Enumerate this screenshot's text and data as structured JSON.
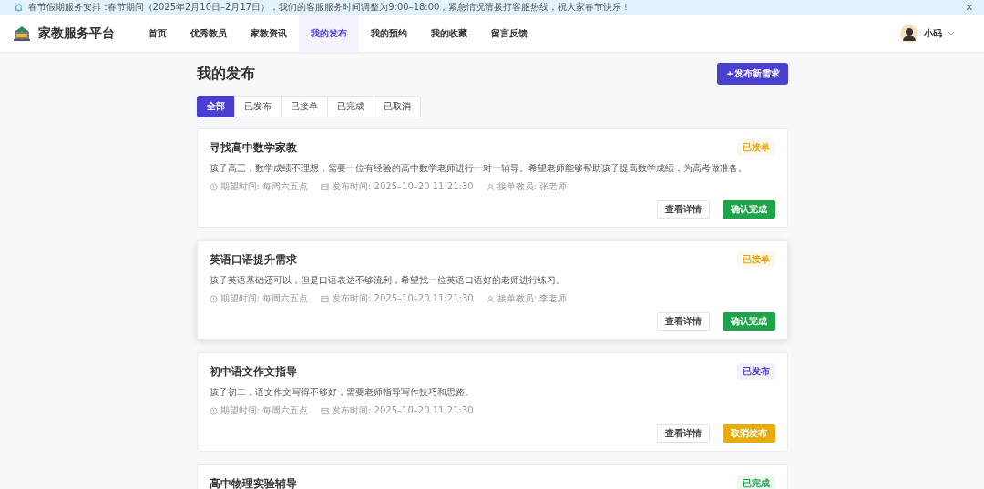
{
  "notice": {
    "text": "春节假期服务安排 :春节期间（2025年2月10日–2月17日），我们的客服服务时间调整为9:00–18:00，紧急情况请拨打客服热线，祝大家春节快乐！",
    "close": "×"
  },
  "header": {
    "brand": "家教服务平台",
    "nav": [
      {
        "label": "首页",
        "selected": false
      },
      {
        "label": "优秀教员",
        "selected": false
      },
      {
        "label": "家教资讯",
        "selected": false
      },
      {
        "label": "我的发布",
        "selected": true
      },
      {
        "label": "我的预约",
        "selected": false
      },
      {
        "label": "我的收藏",
        "selected": false
      },
      {
        "label": "留言反馈",
        "selected": false
      }
    ],
    "user": {
      "name": "小码"
    }
  },
  "page": {
    "title": "我的发布",
    "new_button": "＋发布新需求",
    "filters": [
      {
        "label": "全部",
        "selected": true
      },
      {
        "label": "已发布",
        "selected": false
      },
      {
        "label": "已接单",
        "selected": false
      },
      {
        "label": "已完成",
        "selected": false
      },
      {
        "label": "已取消",
        "selected": false
      }
    ],
    "cards": [
      {
        "title": "寻找高中数学家教",
        "status": "已接单",
        "color": "#e6a817",
        "highlighted": false,
        "description": "孩子高三，数学成绩不理想，需要一位有经验的高中数学老师进行一对一辅导。希望老师能够帮助孩子提高数学成绩，为高考做准备。",
        "expected": "期望时间: 每周六五点",
        "published": "发布时间: 2025–10–20 11:21:30",
        "teacher": "接单教员: 张老师",
        "actions": [
          {
            "label": "查看详情",
            "kind": "outline"
          },
          {
            "label": "确认完成",
            "kind": "success"
          }
        ]
      },
      {
        "title": "英语口语提升需求",
        "status": "已接单",
        "color": "#e6a817",
        "highlighted": true,
        "description": "孩子英语基础还可以，但是口语表达不够流利，希望找一位英语口语好的老师进行练习。",
        "expected": "期望时间: 每周六五点",
        "published": "发布时间: 2025–10–20 11:21:30",
        "teacher": "接单教员: 李老师",
        "actions": [
          {
            "label": "查看详情",
            "kind": "outline"
          },
          {
            "label": "确认完成",
            "kind": "success"
          }
        ]
      },
      {
        "title": "初中语文作文指导",
        "status": "已发布",
        "color": "#4a3fcf",
        "highlighted": false,
        "description": "孩子初二，语文作文写得不够好，需要老师指导写作技巧和思路。",
        "expected": "期望时间: 每周六五点",
        "published": "发布时间: 2025–10–20 11:21:30",
        "actions": [
          {
            "label": "查看详情",
            "kind": "outline"
          },
          {
            "label": "取消发布",
            "kind": "warning"
          }
        ]
      },
      {
        "title": "高中物理实验辅导",
        "status": "已完成",
        "color": "#1fa34a",
        "highlighted": false
      }
    ]
  }
}
